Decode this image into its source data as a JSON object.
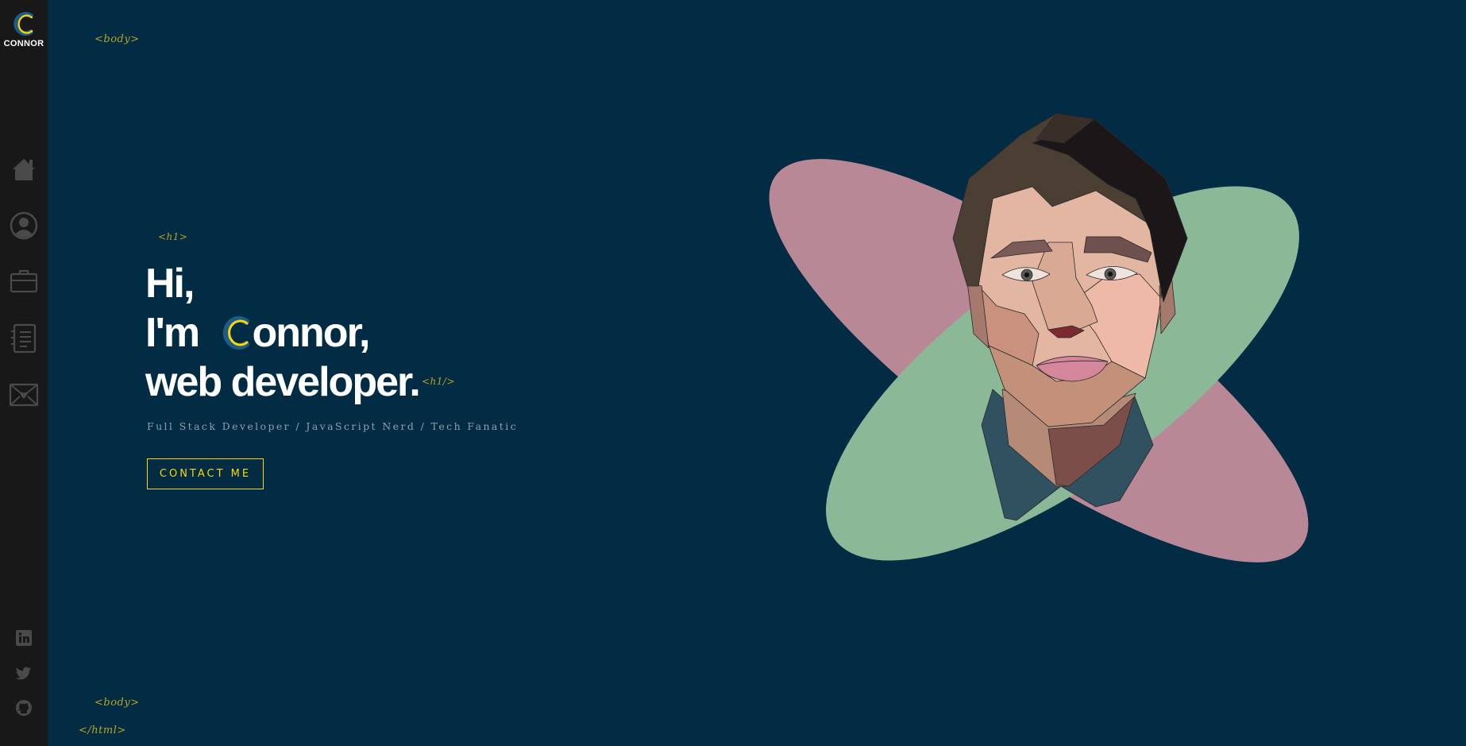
{
  "sidebar": {
    "logo": {
      "letter": "C",
      "name": "CONNOR"
    },
    "nav": [
      {
        "name": "home",
        "icon": "home-icon"
      },
      {
        "name": "about",
        "icon": "user-circle-icon"
      },
      {
        "name": "work",
        "icon": "briefcase-icon"
      },
      {
        "name": "skills",
        "icon": "list-icon"
      },
      {
        "name": "contact",
        "icon": "heart-envelope-icon"
      }
    ],
    "social": [
      {
        "name": "linkedin",
        "icon": "linkedin-icon"
      },
      {
        "name": "twitter",
        "icon": "twitter-icon"
      },
      {
        "name": "github",
        "icon": "github-icon"
      }
    ]
  },
  "tags": {
    "body_open": "<body>",
    "h1_open": "<h1>",
    "h1_close": "<h1/>",
    "body_close": "<body>",
    "html_close": "</html>"
  },
  "hero": {
    "line1": "Hi,",
    "line2_prefix": "I'm",
    "line2_rest": "onnor,",
    "line3": "web developer.",
    "subtitle": "Full Stack Developer / JavaScript Nerd / Tech Fanatic",
    "contact_label": "CONTACT ME"
  },
  "colors": {
    "background": "#022b44",
    "sidebar": "#181818",
    "accent": "#ffd600",
    "tag": "#b6a524",
    "logo_blue": "#1d5c8a",
    "ellipse_pink": "#b98896",
    "ellipse_green": "#8bb998"
  }
}
